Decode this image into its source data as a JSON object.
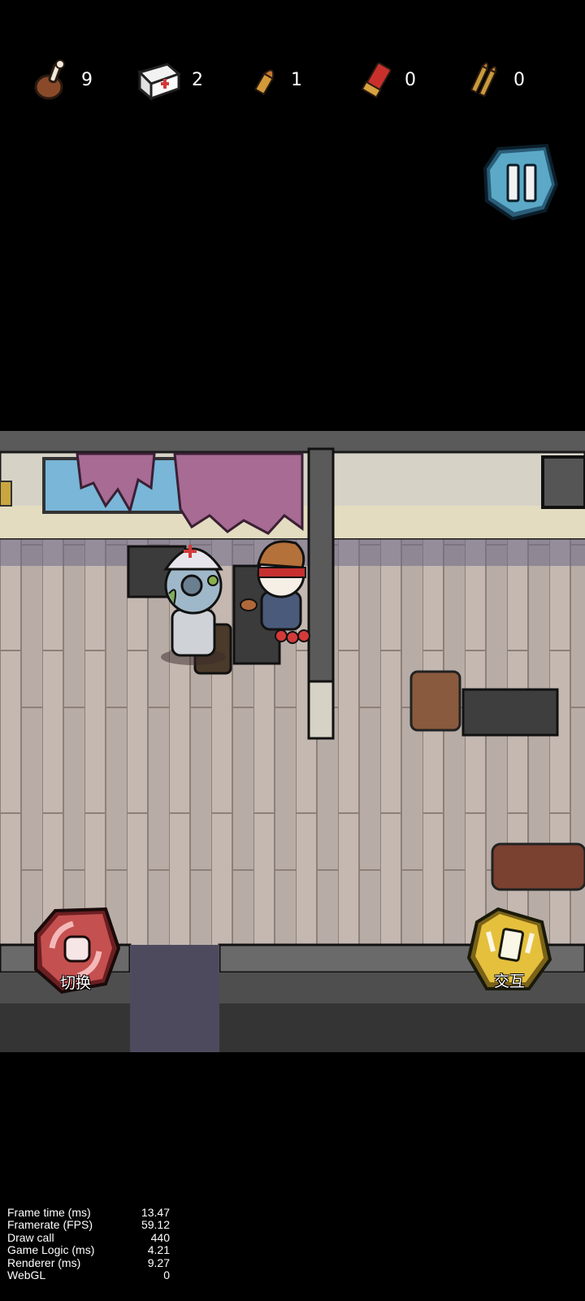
{
  "hud": {
    "food_count": "9",
    "medkit_count": "2",
    "pistol_ammo_count": "1",
    "shotgun_ammo_count": "0",
    "rifle_ammo_count": "0"
  },
  "buttons": {
    "switch_label": "切换",
    "interact_label": "交互"
  },
  "debug": [
    {
      "label": "Frame time (ms)",
      "value": "13.47"
    },
    {
      "label": "Framerate (FPS)",
      "value": "59.12"
    },
    {
      "label": "Draw call",
      "value": "440"
    },
    {
      "label": "Game Logic (ms)",
      "value": "4.21"
    },
    {
      "label": "Renderer (ms)",
      "value": "9.27"
    },
    {
      "label": "WebGL",
      "value": "0"
    }
  ],
  "colors": {
    "background": "#000000",
    "floor": "#b9aca4",
    "wall": "#d8d5cb",
    "pause_button": "#5ba9c7",
    "switch_button": "#c4504f",
    "interact_button": "#e5c03c"
  }
}
